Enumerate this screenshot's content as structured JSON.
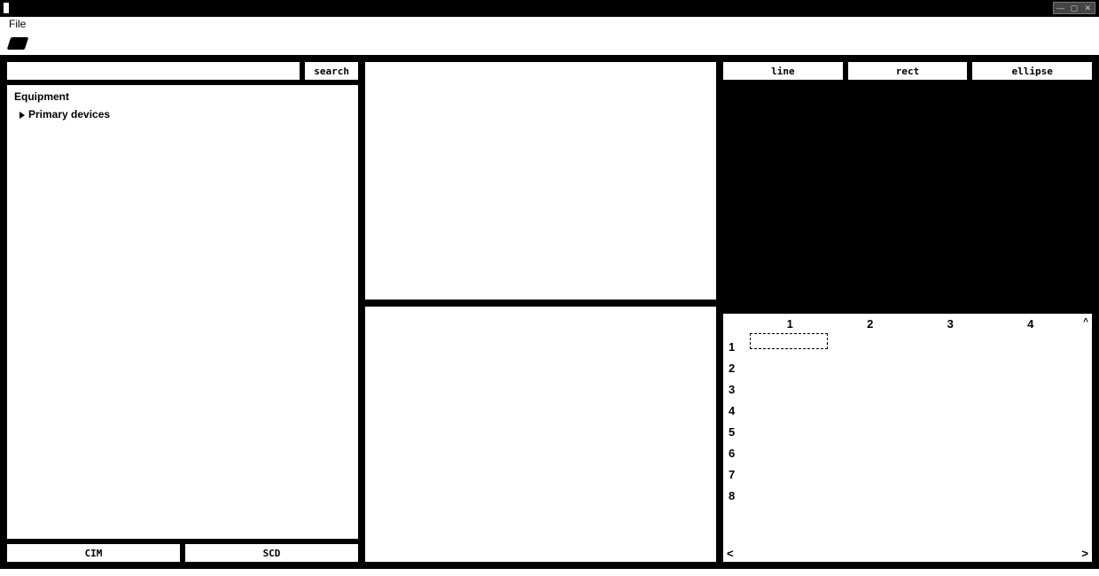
{
  "titlebar": {
    "win_controls": "⎯ ▢ ✕"
  },
  "menubar": {
    "file": "File"
  },
  "toolbar": {
    "open": "open"
  },
  "search": {
    "button": "search"
  },
  "tree": {
    "root": "Equipment",
    "child1": "Primary devices"
  },
  "tabs": {
    "left": "CIM",
    "right": "SCD"
  },
  "shapes": {
    "line": "line",
    "rect": "rect",
    "ellipse": "ellipse"
  },
  "grid": {
    "cols": [
      "1",
      "2",
      "3",
      "4"
    ],
    "rows": [
      "1",
      "2",
      "3",
      "4",
      "5",
      "6",
      "7",
      "8"
    ],
    "scroll_left": "<",
    "scroll_right": ">",
    "scroll_up": "^"
  }
}
